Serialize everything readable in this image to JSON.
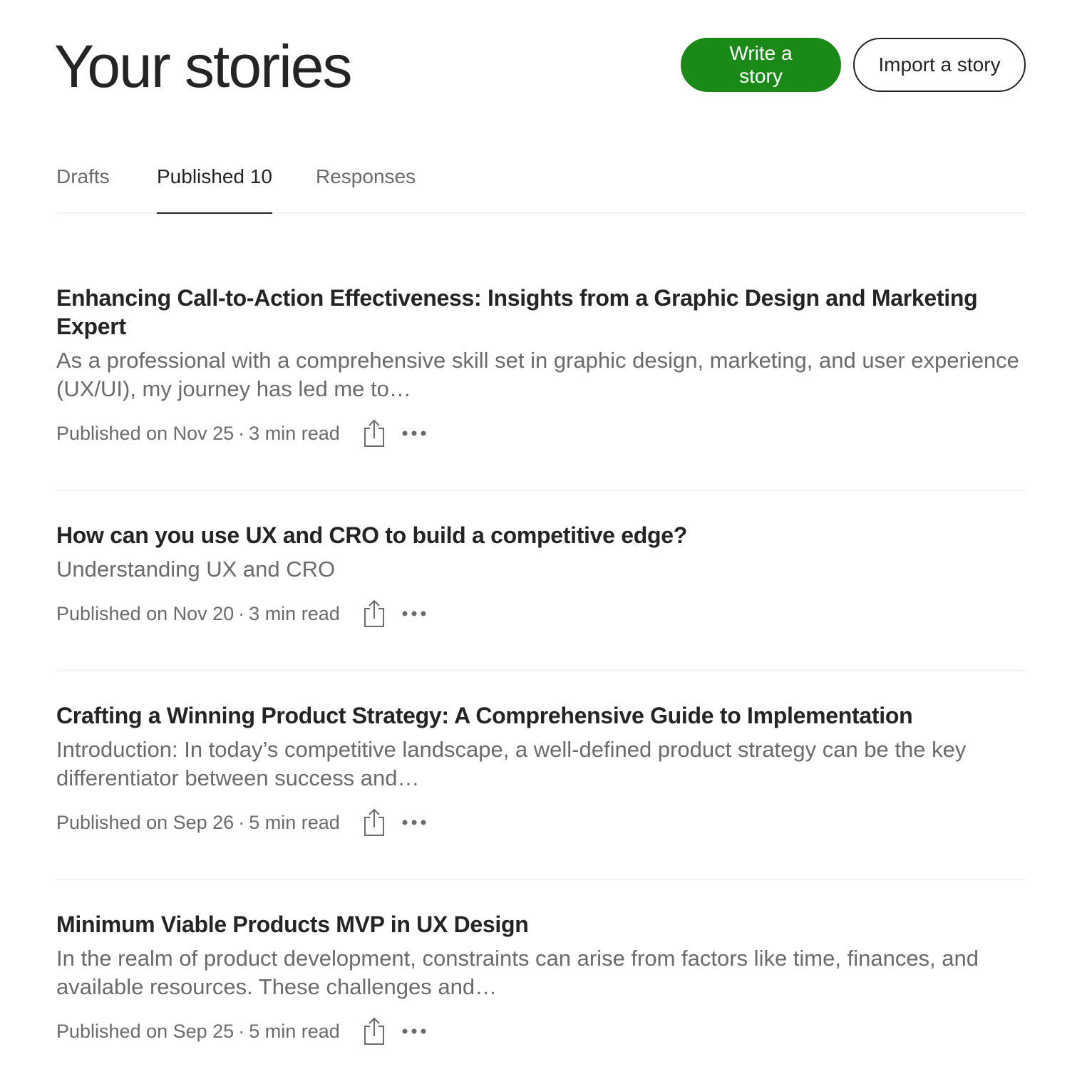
{
  "header": {
    "title": "Your stories",
    "write_label": "Write a story",
    "import_label": "Import a story"
  },
  "tabs": [
    {
      "label": "Drafts",
      "active": false
    },
    {
      "label": "Published 10",
      "active": true
    },
    {
      "label": "Responses",
      "active": false
    }
  ],
  "stories": [
    {
      "title": "Enhancing Call-to-Action Effectiveness: Insights from a Graphic Design and Marketing Expert",
      "excerpt": "As a professional with a comprehensive skill set in graphic design, marketing, and user experience (UX/UI), my journey has led me to…",
      "published": "Published on Nov 25",
      "separator": "·",
      "read_time": "3 min read"
    },
    {
      "title": "How can you use UX and CRO to build a competitive edge?",
      "excerpt": "Understanding UX and CRO",
      "published": "Published on Nov 20",
      "separator": "·",
      "read_time": "3 min read"
    },
    {
      "title": "Crafting a Winning Product Strategy: A Comprehensive Guide to Implementation",
      "excerpt": "Introduction: In today’s competitive landscape, a well-defined product strategy can be the key differentiator between success and…",
      "published": "Published on Sep 26",
      "separator": "·",
      "read_time": "5 min read"
    },
    {
      "title": "Minimum Viable Products MVP in UX Design",
      "excerpt": "In the realm of product development, constraints can arise from factors like time, finances, and available resources. These challenges and…",
      "published": "Published on Sep 25",
      "separator": "·",
      "read_time": "5 min read"
    }
  ],
  "icons": {
    "share": "share-icon",
    "more": "more-options-icon"
  },
  "colors": {
    "primary": "#1a8917",
    "text": "#242424",
    "muted": "#6b6b6b",
    "divider": "#f2f2f2"
  }
}
